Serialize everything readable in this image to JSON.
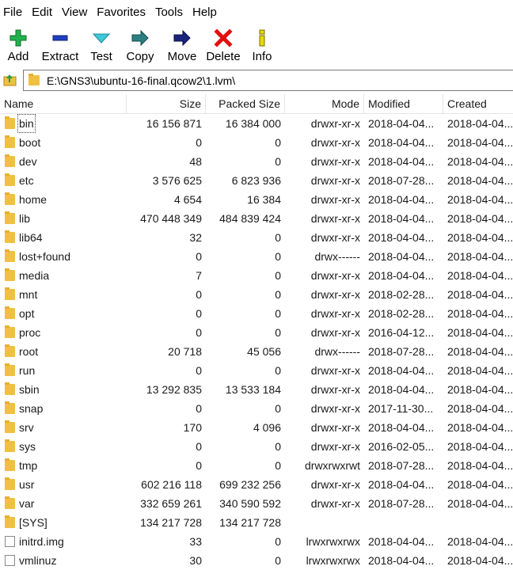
{
  "menu": [
    "File",
    "Edit",
    "View",
    "Favorites",
    "Tools",
    "Help"
  ],
  "toolbar": [
    {
      "label": "Add",
      "icon": "plus-icon",
      "color": "#22b14c"
    },
    {
      "label": "Extract",
      "icon": "minus-icon",
      "color": "#1f3fbf"
    },
    {
      "label": "Test",
      "icon": "check-icon",
      "color": "#3ec8d8"
    },
    {
      "label": "Copy",
      "icon": "copy-arrow-icon",
      "color": "#2a8080"
    },
    {
      "label": "Move",
      "icon": "move-arrow-icon",
      "color": "#1a237e"
    },
    {
      "label": "Delete",
      "icon": "x-icon",
      "color": "#e01010"
    },
    {
      "label": "Info",
      "icon": "info-icon",
      "color": "#e8d800"
    }
  ],
  "address": {
    "path": "E:\\GNS3\\ubuntu-16-final.qcow2\\1.lvm\\"
  },
  "columns": {
    "name": "Name",
    "size": "Size",
    "packed": "Packed Size",
    "mode": "Mode",
    "modified": "Modified",
    "created": "Created"
  },
  "rows": [
    {
      "name": "bin",
      "size": "16 156 871",
      "packed": "16 384 000",
      "mode": "drwxr-xr-x",
      "modified": "2018-04-04...",
      "created": "2018-04-04...",
      "kind": "folder"
    },
    {
      "name": "boot",
      "size": "0",
      "packed": "0",
      "mode": "drwxr-xr-x",
      "modified": "2018-04-04...",
      "created": "2018-04-04...",
      "kind": "folder"
    },
    {
      "name": "dev",
      "size": "48",
      "packed": "0",
      "mode": "drwxr-xr-x",
      "modified": "2018-04-04...",
      "created": "2018-04-04...",
      "kind": "folder"
    },
    {
      "name": "etc",
      "size": "3 576 625",
      "packed": "6 823 936",
      "mode": "drwxr-xr-x",
      "modified": "2018-07-28...",
      "created": "2018-04-04...",
      "kind": "folder"
    },
    {
      "name": "home",
      "size": "4 654",
      "packed": "16 384",
      "mode": "drwxr-xr-x",
      "modified": "2018-04-04...",
      "created": "2018-04-04...",
      "kind": "folder"
    },
    {
      "name": "lib",
      "size": "470 448 349",
      "packed": "484 839 424",
      "mode": "drwxr-xr-x",
      "modified": "2018-04-04...",
      "created": "2018-04-04...",
      "kind": "folder"
    },
    {
      "name": "lib64",
      "size": "32",
      "packed": "0",
      "mode": "drwxr-xr-x",
      "modified": "2018-04-04...",
      "created": "2018-04-04...",
      "kind": "folder"
    },
    {
      "name": "lost+found",
      "size": "0",
      "packed": "0",
      "mode": "drwx------",
      "modified": "2018-04-04...",
      "created": "2018-04-04...",
      "kind": "folder"
    },
    {
      "name": "media",
      "size": "7",
      "packed": "0",
      "mode": "drwxr-xr-x",
      "modified": "2018-04-04...",
      "created": "2018-04-04...",
      "kind": "folder"
    },
    {
      "name": "mnt",
      "size": "0",
      "packed": "0",
      "mode": "drwxr-xr-x",
      "modified": "2018-02-28...",
      "created": "2018-04-04...",
      "kind": "folder"
    },
    {
      "name": "opt",
      "size": "0",
      "packed": "0",
      "mode": "drwxr-xr-x",
      "modified": "2018-02-28...",
      "created": "2018-04-04...",
      "kind": "folder"
    },
    {
      "name": "proc",
      "size": "0",
      "packed": "0",
      "mode": "drwxr-xr-x",
      "modified": "2016-04-12...",
      "created": "2018-04-04...",
      "kind": "folder"
    },
    {
      "name": "root",
      "size": "20 718",
      "packed": "45 056",
      "mode": "drwx------",
      "modified": "2018-07-28...",
      "created": "2018-04-04...",
      "kind": "folder"
    },
    {
      "name": "run",
      "size": "0",
      "packed": "0",
      "mode": "drwxr-xr-x",
      "modified": "2018-04-04...",
      "created": "2018-04-04...",
      "kind": "folder"
    },
    {
      "name": "sbin",
      "size": "13 292 835",
      "packed": "13 533 184",
      "mode": "drwxr-xr-x",
      "modified": "2018-04-04...",
      "created": "2018-04-04...",
      "kind": "folder"
    },
    {
      "name": "snap",
      "size": "0",
      "packed": "0",
      "mode": "drwxr-xr-x",
      "modified": "2017-11-30...",
      "created": "2018-04-04...",
      "kind": "folder"
    },
    {
      "name": "srv",
      "size": "170",
      "packed": "4 096",
      "mode": "drwxr-xr-x",
      "modified": "2018-04-04...",
      "created": "2018-04-04...",
      "kind": "folder"
    },
    {
      "name": "sys",
      "size": "0",
      "packed": "0",
      "mode": "drwxr-xr-x",
      "modified": "2016-02-05...",
      "created": "2018-04-04...",
      "kind": "folder"
    },
    {
      "name": "tmp",
      "size": "0",
      "packed": "0",
      "mode": "drwxrwxrwt",
      "modified": "2018-07-28...",
      "created": "2018-04-04...",
      "kind": "folder"
    },
    {
      "name": "usr",
      "size": "602 216 118",
      "packed": "699 232 256",
      "mode": "drwxr-xr-x",
      "modified": "2018-04-04...",
      "created": "2018-04-04...",
      "kind": "folder"
    },
    {
      "name": "var",
      "size": "332 659 261",
      "packed": "340 590 592",
      "mode": "drwxr-xr-x",
      "modified": "2018-07-28...",
      "created": "2018-04-04...",
      "kind": "folder"
    },
    {
      "name": "[SYS]",
      "size": "134 217 728",
      "packed": "134 217 728",
      "mode": "",
      "modified": "",
      "created": "",
      "kind": "folder"
    },
    {
      "name": "initrd.img",
      "size": "33",
      "packed": "0",
      "mode": "lrwxrwxrwx",
      "modified": "2018-04-04...",
      "created": "2018-04-04...",
      "kind": "file"
    },
    {
      "name": "vmlinuz",
      "size": "30",
      "packed": "0",
      "mode": "lrwxrwxrwx",
      "modified": "2018-04-04...",
      "created": "2018-04-04...",
      "kind": "file"
    }
  ]
}
